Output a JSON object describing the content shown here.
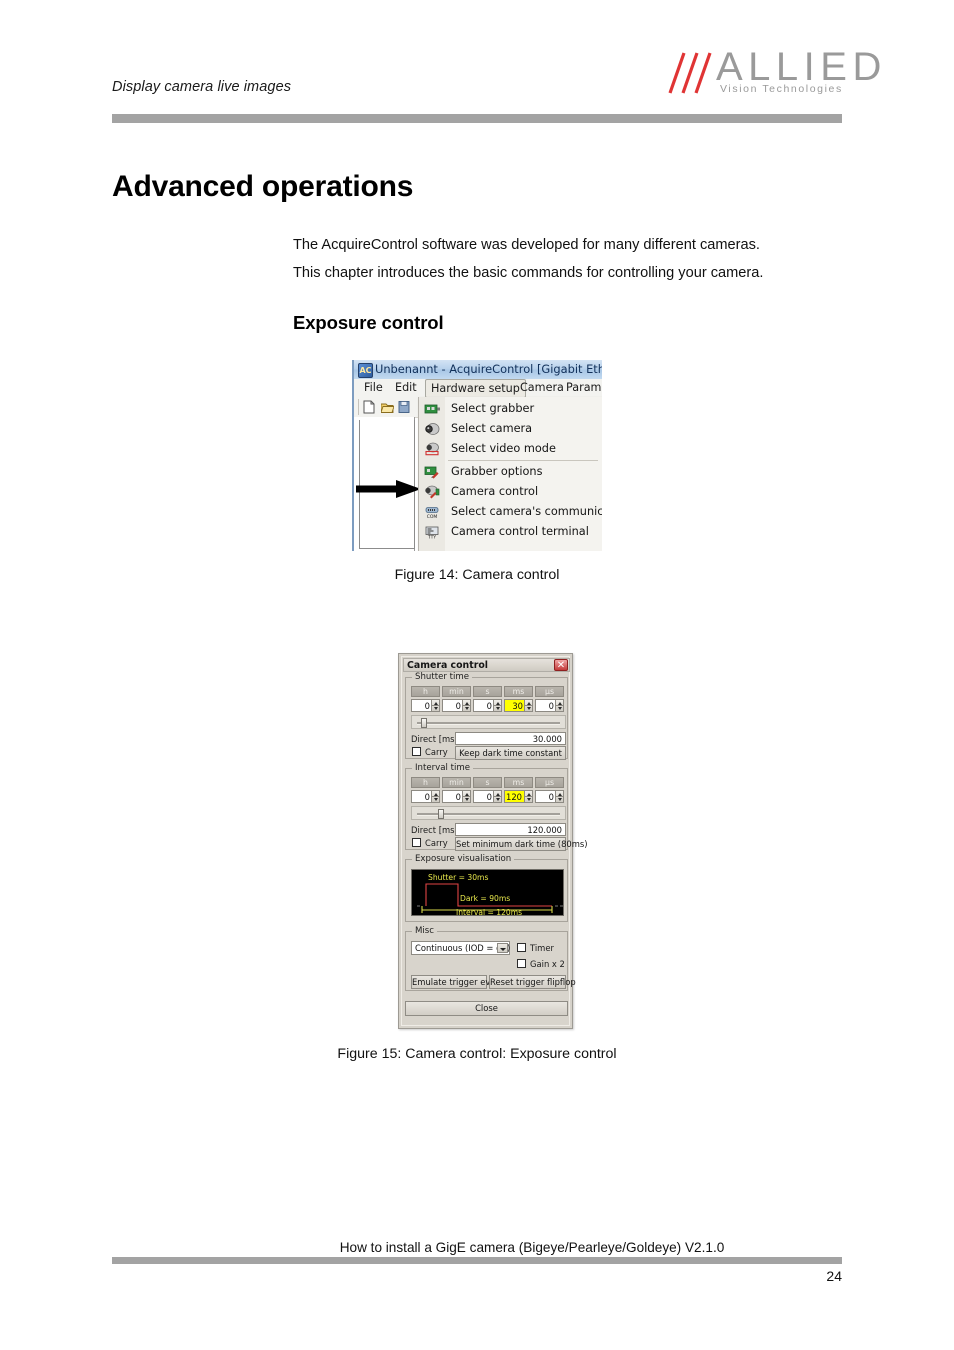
{
  "header": {
    "running_title": "Display camera live images",
    "logo_word": "ALLIED",
    "logo_sub": "Vision Technologies",
    "logo_slash_color": "#e03434",
    "logo_text_color": "#9a9a9a",
    "rule_color": "#a3a3a3"
  },
  "body": {
    "heading1": "Advanced operations",
    "paragraph1": "The AcquireControl software was developed for many different cameras.",
    "paragraph2": "This chapter introduces the basic commands for controlling your camera.",
    "heading2": "Exposure control",
    "caption14": "Figure 14: Camera control",
    "caption15": "Figure 15: Camera control: Exposure control"
  },
  "footer": {
    "document_title": "How to install a GigE camera (Bigeye/Pearleye/Goldeye) V2.1.0",
    "page_number": "24"
  },
  "figure14": {
    "window_title": "Unbenannt - AcquireControl [Gigabit Ethernet",
    "app_icon_text": "AC",
    "menubar": [
      {
        "label": "File",
        "active": false
      },
      {
        "label": "Edit",
        "active": false
      },
      {
        "label": "Hardware setup",
        "active": true
      },
      {
        "label": "Camera",
        "active": false
      },
      {
        "label": "Parame",
        "active": false
      }
    ],
    "toolbar_icons": [
      "new-document-icon",
      "open-folder-icon",
      "save-icon"
    ],
    "dropdown_items": [
      {
        "label": "Select grabber",
        "accel": "g",
        "icon": "grabber-board-icon",
        "separator_after": false
      },
      {
        "label": "Select camera",
        "accel": "c",
        "icon": "camera-lens-icon",
        "separator_after": false
      },
      {
        "label": "Select video mode",
        "accel": "v",
        "icon": "video-mode-icon",
        "separator_after": true
      },
      {
        "label": "Grabber options",
        "accel": "o",
        "icon": "grabber-options-icon",
        "separator_after": false
      },
      {
        "label": "Camera control",
        "accel": "r",
        "icon": "camera-control-icon",
        "separator_after": false
      },
      {
        "label": "Select camera's communication",
        "accel": "",
        "icon": "com-port-icon",
        "separator_after": false
      },
      {
        "label": "Camera control terminal",
        "accel": "",
        "icon": "tty-terminal-icon",
        "separator_after": false
      }
    ],
    "annotation": "black-arrow-pointing-to-camera-control"
  },
  "figure15": {
    "title": "Camera control",
    "close_glyph": "✕",
    "shutter_group": {
      "legend": "Shutter time",
      "units": [
        "h",
        "min",
        "s",
        "ms",
        "µs"
      ],
      "values": [
        "0",
        "0",
        "0",
        "30",
        "0"
      ],
      "highlight_index": 3,
      "highlight_color": "#ffff00",
      "slider_position_pct": 6,
      "direct_label": "Direct [ms]",
      "direct_value": "30.000",
      "carry_label": "Carry",
      "carry_checked": false,
      "button_label": "Keep dark time constant"
    },
    "interval_group": {
      "legend": "Interval time",
      "units": [
        "h",
        "min",
        "s",
        "ms",
        "µs"
      ],
      "values": [
        "0",
        "0",
        "0",
        "120",
        "0"
      ],
      "highlight_index": 3,
      "highlight_color": "#ffff00",
      "slider_position_pct": 17,
      "direct_label": "Direct [ms]",
      "direct_value": "120.000",
      "carry_label": "Carry",
      "carry_checked": false,
      "button_label": "Set minimum dark time (80ms)"
    },
    "visualisation": {
      "legend": "Exposure visualisation",
      "background": "#000000",
      "shutter_text": "Shutter = 30ms",
      "dark_text": "Dark = 90ms",
      "interval_text": "Interval = 120ms",
      "pulse_color": "#e04444",
      "baseline_color": "#d8d84a",
      "label_color": "#e8e84c"
    },
    "misc": {
      "legend": "Misc",
      "mode_value": "Continuous (IOD = off)",
      "timer_label": "Timer",
      "timer_checked": false,
      "gain_label": "Gain x 2",
      "gain_checked": false,
      "emulate_button": "Emulate trigger event",
      "reset_button": "Reset trigger flipflop"
    },
    "close_button": "Close"
  }
}
